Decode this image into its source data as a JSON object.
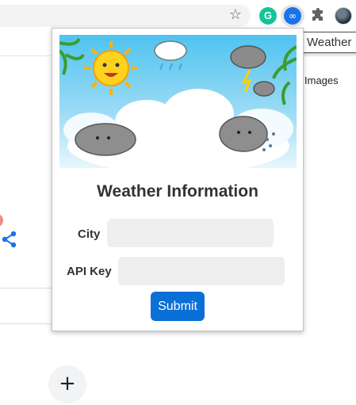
{
  "browser": {
    "tooltip": "Weather",
    "extensions": {
      "grammarly_letter": "G",
      "weather_symbol": "∞"
    },
    "star_glyph": "☆"
  },
  "page": {
    "images_link": "Images",
    "fab_glyph": "+"
  },
  "popup": {
    "title": "Weather Information",
    "city_label": "City",
    "city_value": "",
    "api_key_label": "API Key",
    "api_key_value": "",
    "submit_label": "Submit"
  },
  "colors": {
    "accent": "#0a6fd6",
    "field_bg": "#eeeeee",
    "grammarly": "#15c39a",
    "share_icon": "#1a73e8"
  }
}
